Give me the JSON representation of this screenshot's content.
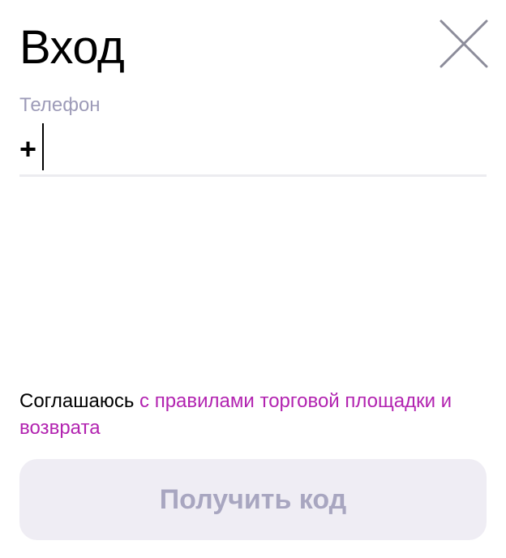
{
  "header": {
    "title": "Вход",
    "close_icon": "close-icon"
  },
  "phone": {
    "label": "Телефон",
    "value": "+"
  },
  "agreement": {
    "prefix": "Соглашаюсь ",
    "link": "с правилами торговой площадки и возврата"
  },
  "submit": {
    "label": "Получить код"
  },
  "colors": {
    "link": "#b223b0",
    "label": "#9d9bb8",
    "button_bg": "#efedf4",
    "button_text": "#a8a6c0"
  }
}
